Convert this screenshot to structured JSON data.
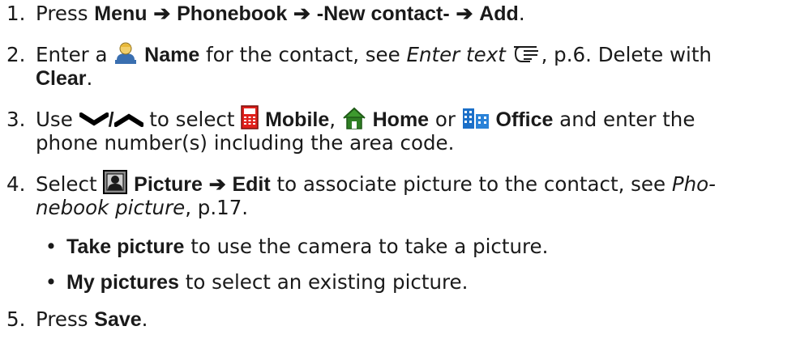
{
  "steps": [
    {
      "num": "1.",
      "a": "Press ",
      "menu": "Menu",
      "phonebook": "Phonebook",
      "new_contact": "-New contact-",
      "add": "Add",
      "end": "."
    },
    {
      "num": "2.",
      "a": "Enter a ",
      "name": "Name",
      "b": " for the contact, see ",
      "ref": "Enter text",
      "c": ", p.6. Delete with",
      "clear": "Clear",
      "end": "."
    },
    {
      "num": "3.",
      "a": "Use ",
      "slash": "/",
      "b": " to select ",
      "mobile": "Mobile",
      "comma": ", ",
      "home": "Home",
      "or": " or ",
      "office": "Office",
      "c": " and enter the",
      "d": "phone number(s) including the area code."
    },
    {
      "num": "4.",
      "a": "Select ",
      "picture": "Picture",
      "edit": "Edit",
      "b": " to associate picture to the contact, see ",
      "ref1": "Pho-",
      "ref2": "nebook picture",
      "c": ", p.17.",
      "bullets": [
        {
          "bold": "Take picture",
          "text": " to use the camera to take a picture."
        },
        {
          "bold": "My pictures",
          "text": " to select an existing picture."
        }
      ]
    },
    {
      "num": "5.",
      "a": "Press ",
      "save": "Save",
      "end": "."
    }
  ],
  "arrow_glyph": "➔",
  "bullet_glyph": "•",
  "icons": [
    "contact-person-icon",
    "hand-pointer-icon",
    "nav-down-icon",
    "nav-up-icon",
    "mobile-phone-icon",
    "home-icon",
    "office-building-icon",
    "picture-frame-icon"
  ],
  "colors": {
    "text": "#1a1a1a",
    "mobile_red": "#e0201b",
    "home_green": "#2f7f24",
    "office_blue": "#1b6fc8"
  }
}
